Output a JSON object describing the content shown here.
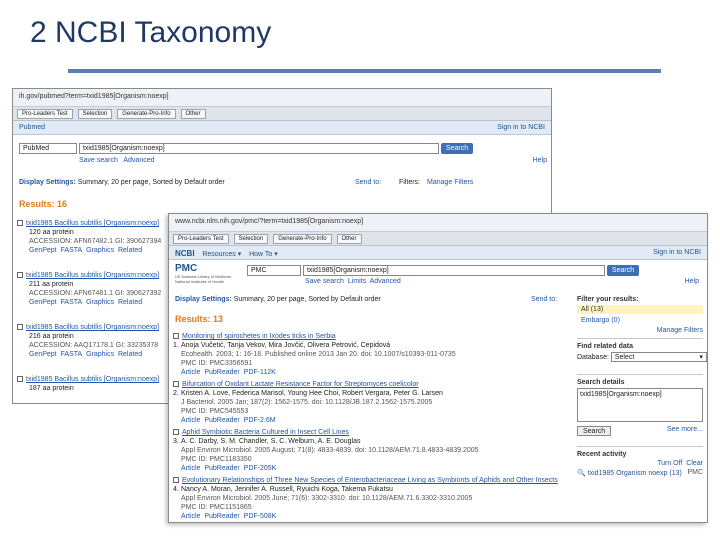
{
  "slide": {
    "title": "2 NCBI Taxonomy"
  },
  "back": {
    "url": "ih.gov/pubmed?term=txid1985[Organism:noexp]",
    "tabs": [
      "Pro-Leaders Test",
      "Selection",
      "Generate-Pro-Info",
      "Other"
    ],
    "ncbi_left": "Pubmed",
    "ncbi_right": "Sign in to NCBI",
    "db": "PubMed",
    "query": "txid1985[Organism:noexp]",
    "search": "Search",
    "save_search": "Save search",
    "advanced": "Advanced",
    "help": "Help",
    "display": "Display Settings:",
    "display_value": "Summary, 20 per page, Sorted by Default order",
    "send_to": "Send to:",
    "filters": "Filters:",
    "manage_filters": "Manage Filters",
    "results": "Results: 16",
    "items": [
      {
        "title": "txid1985 Bacillus subtilis [Organism:noexp]",
        "sub": "120 aa protein",
        "meta": "ACCESSION: AFN67482.1  GI: 390627394",
        "links": [
          "GenPept",
          "FASTA",
          "Graphics",
          "Related"
        ]
      },
      {
        "title": "txid1985 Bacillus subtilis [Organism:noexp]",
        "sub": "211 aa protein",
        "meta": "ACCESSION: AFN67481.1  GI: 390627392",
        "links": [
          "GenPept",
          "FASTA",
          "Graphics",
          "Related"
        ]
      },
      {
        "title": "txid1985 Bacillus subtilis [Organism:noexp]",
        "sub": "216 aa protein",
        "meta": "ACCESSION: AAQ17178.1  GI: 33235378",
        "links": [
          "GenPept",
          "FASTA",
          "Graphics",
          "Related"
        ]
      },
      {
        "title": "txid1985 Bacillus subtilis [Organism:noexp]",
        "sub": "187 aa protein",
        "meta": "",
        "links": []
      }
    ]
  },
  "front": {
    "url": "www.ncbi.nlm.nih.gov/pmc/?term=txid1985[Organism:noexp]",
    "tabs": [
      "Pro-Leaders Test",
      "Selection",
      "Generate-Pro-Info",
      "Other"
    ],
    "ncbi": "NCBI",
    "resources": "Resources",
    "howto": "How To",
    "sign_in": "Sign in to NCBI",
    "logo_title": "PMC",
    "logo_sub": "US National Library of Medicine National Institutes of Health",
    "db": "PMC",
    "query": "txid1985[Organism:noexp]",
    "search": "Search",
    "save_search": "Save search",
    "limits": "Limits",
    "advanced": "Advanced",
    "help": "Help",
    "display": "Display Settings:",
    "display_value": "Summary, 20 per page, Sorted by Default order",
    "send_to": "Send to:",
    "results": "Results: 13",
    "items": [
      {
        "n": "1.",
        "title": "Monitoring of spirochetes in Ixodes ticks in Serbia",
        "authors": "Anoja Vučetić, Tanja Vekov, Mira Jovčić, Olivera Petrović, Cepidová",
        "journal": "Ecohealth. 2003; 1: 16-18. Published online 2013 Jan 20. doi: 10.1007/s10393-011-0735",
        "pmc": "PMC ID: PMC3356591",
        "links": [
          "Article",
          "PubReader",
          "PDF-112K"
        ]
      },
      {
        "n": "2.",
        "title": "Bifurcation of Oxidant Lactate Resistance Factor for Streptomyces coelicolor",
        "authors": "Kristen A. Love, Federica Marisol, Young Hee Choi, Robert Vergara, Peter G. Larsen",
        "journal": "J Bacteriol. 2005 Jan; 187(2): 1562-1575. doi: 10.1128/JB.187.2.1562-1575.2005",
        "pmc": "PMC ID: PMC545553",
        "links": [
          "Article",
          "PubReader",
          "PDF-2.6M"
        ]
      },
      {
        "n": "3.",
        "title": "Aphid Symbiotic Bacteria Cultured in Insect Cell Lines",
        "authors": "A. C. Darby, S. M. Chandler, S. C. Welburn, A. E. Douglas",
        "journal": "Appl Environ Microbiol. 2005 August; 71(8): 4833-4839. doi: 10.1128/AEM.71.8.4833-4839.2005",
        "pmc": "PMC ID: PMC1183350",
        "links": [
          "Article",
          "PubReader",
          "PDF-205K"
        ]
      },
      {
        "n": "4.",
        "title": "Evolutionary Relationships of Three New Species of Enterobacteriaceae Living as Symbionts of Aphids and Other Insects",
        "authors": "Nancy A. Moran, Jennifer A. Russell, Ryuichi Koga, Takema Fukatsu",
        "journal": "Appl Environ Microbiol. 2005 June; 71(6): 3302-3310. doi: 10.1128/AEM.71.6.3302-3310.2005",
        "pmc": "PMC ID: PMC1151865",
        "links": [
          "Article",
          "PubReader",
          "PDF-508K"
        ]
      }
    ],
    "filter_title": "Filter your results:",
    "filter_all": "All (13)",
    "filter_other": "Embargo (0)",
    "manage_filters": "Manage Filters",
    "related_title": "Find related data",
    "database_label": "Database:",
    "database_value": "Select",
    "search_details": "Search details",
    "details_query": "txid1985[Organism:noexp]",
    "details_search": "Search",
    "see_more": "See more...",
    "recent_activity": "Recent activity",
    "turn_off": "Turn Off",
    "clear": "Clear",
    "recent_item": "txid1985 Organism noexp (13)",
    "recent_db": "PMC"
  }
}
